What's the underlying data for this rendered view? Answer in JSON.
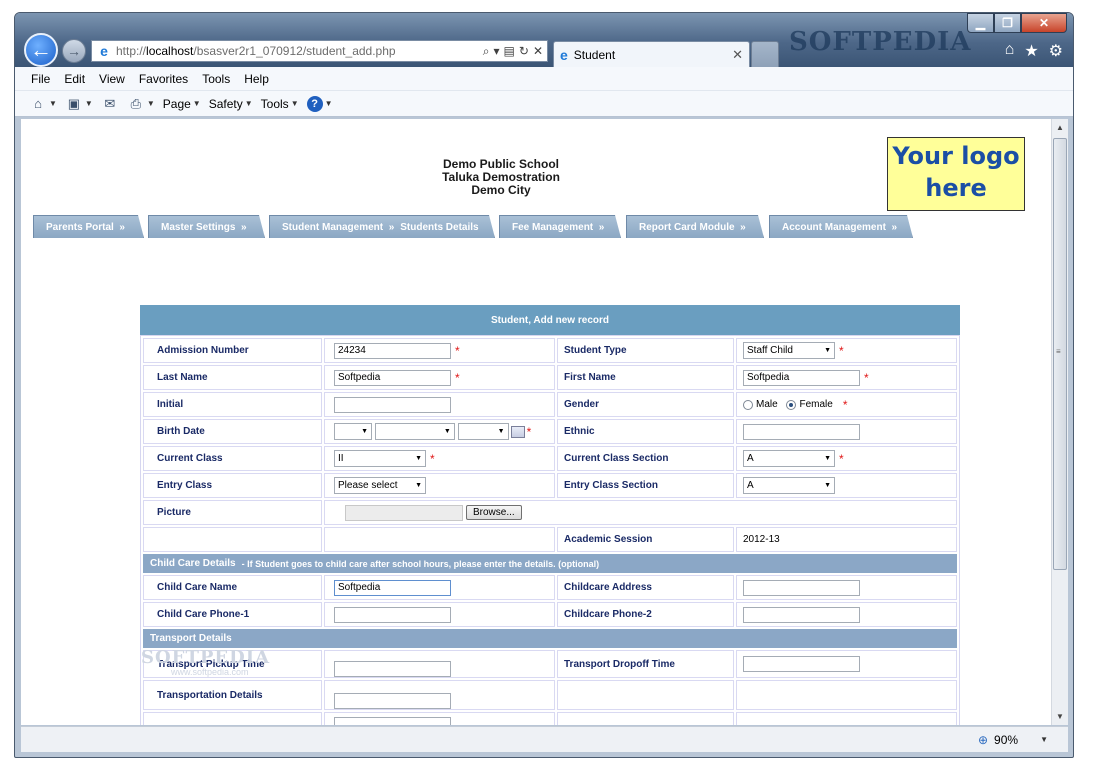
{
  "browser": {
    "url_prefix": "http://",
    "url_host": "localhost",
    "url_path": "/bsasver2r1_070912/student_add.php",
    "tab_title": "Student",
    "watermark": "SOFTPEDIA",
    "menu": [
      "File",
      "Edit",
      "View",
      "Favorites",
      "Tools",
      "Help"
    ],
    "commands": {
      "page": "Page",
      "safety": "Safety",
      "tools": "Tools"
    },
    "zoom": "90%"
  },
  "school": {
    "name": "Demo Public School",
    "line2": "Taluka Demostration",
    "line3": "Demo City",
    "logo_line1": "Your logo",
    "logo_line2": "here"
  },
  "nav": [
    {
      "label": "Parents Portal",
      "suffix": "»"
    },
    {
      "label": "Master Settings",
      "suffix": "»"
    },
    {
      "label": "Student Management",
      "suffix": "»",
      "sub": "Students Details"
    },
    {
      "label": "Fee Management",
      "suffix": "»"
    },
    {
      "label": "Report Card Module",
      "suffix": "»"
    },
    {
      "label": "Account Management",
      "suffix": "»"
    }
  ],
  "form": {
    "heading": "Student, Add new record",
    "admission_label": "Admission Number",
    "admission_value": "24234",
    "student_type_label": "Student Type",
    "student_type_value": "Staff Child",
    "last_name_label": "Last Name",
    "last_name_value": "Softpedia",
    "first_name_label": "First Name",
    "first_name_value": "Softpedia",
    "initial_label": "Initial",
    "initial_value": "",
    "gender_label": "Gender",
    "gender_male": "Male",
    "gender_female": "Female",
    "birth_label": "Birth Date",
    "ethnic_label": "Ethnic",
    "ethnic_value": "",
    "current_class_label": "Current Class",
    "current_class_value": "II",
    "current_section_label": "Current Class Section",
    "current_section_value": "A",
    "entry_class_label": "Entry Class",
    "entry_class_value": "Please select",
    "entry_section_label": "Entry Class Section",
    "entry_section_value": "A",
    "picture_label": "Picture",
    "browse_label": "Browse...",
    "session_label": "Academic Session",
    "session_value": "2012-13",
    "required_mark": "*"
  },
  "childcare": {
    "heading": "Child Care Details",
    "note": "- If Student goes to child care after school hours, please enter the details. (optional)",
    "name_label": "Child Care Name",
    "name_value": "Softpedia",
    "address_label": "Childcare Address",
    "phone1_label": "Child Care Phone-1",
    "phone2_label": "Childcare Phone-2"
  },
  "transport": {
    "heading": "Transport Details",
    "pickup_label": "Transport Pickup Time",
    "dropoff_label": "Transport Dropoff Time",
    "details_label": "Transportation Details"
  },
  "overlay_watermark": {
    "text": "SOFTPEDIA",
    "sub": "www.softpedia.com"
  }
}
